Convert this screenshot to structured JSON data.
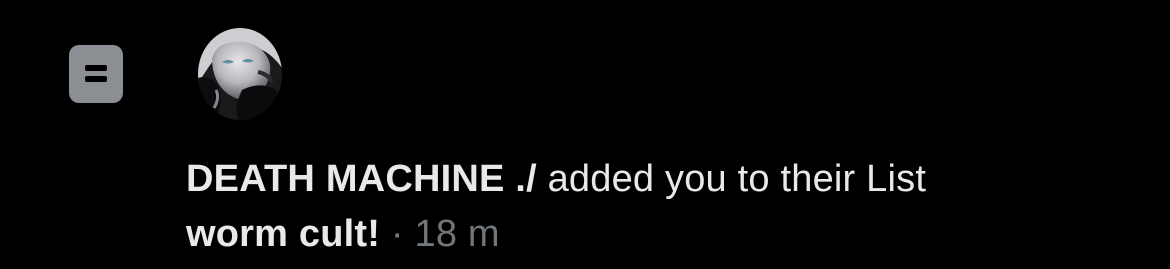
{
  "notification": {
    "icon": "list-icon",
    "user_name": "DEATH MACHINE ./",
    "action_text": " added you to their List",
    "list_name": "worm cult!",
    "separator": " · ",
    "time": "18 m"
  },
  "colors": {
    "background": "#000000",
    "text_primary": "#e7e9ea",
    "text_muted": "#71767b",
    "icon_bg": "#8b8f94"
  }
}
